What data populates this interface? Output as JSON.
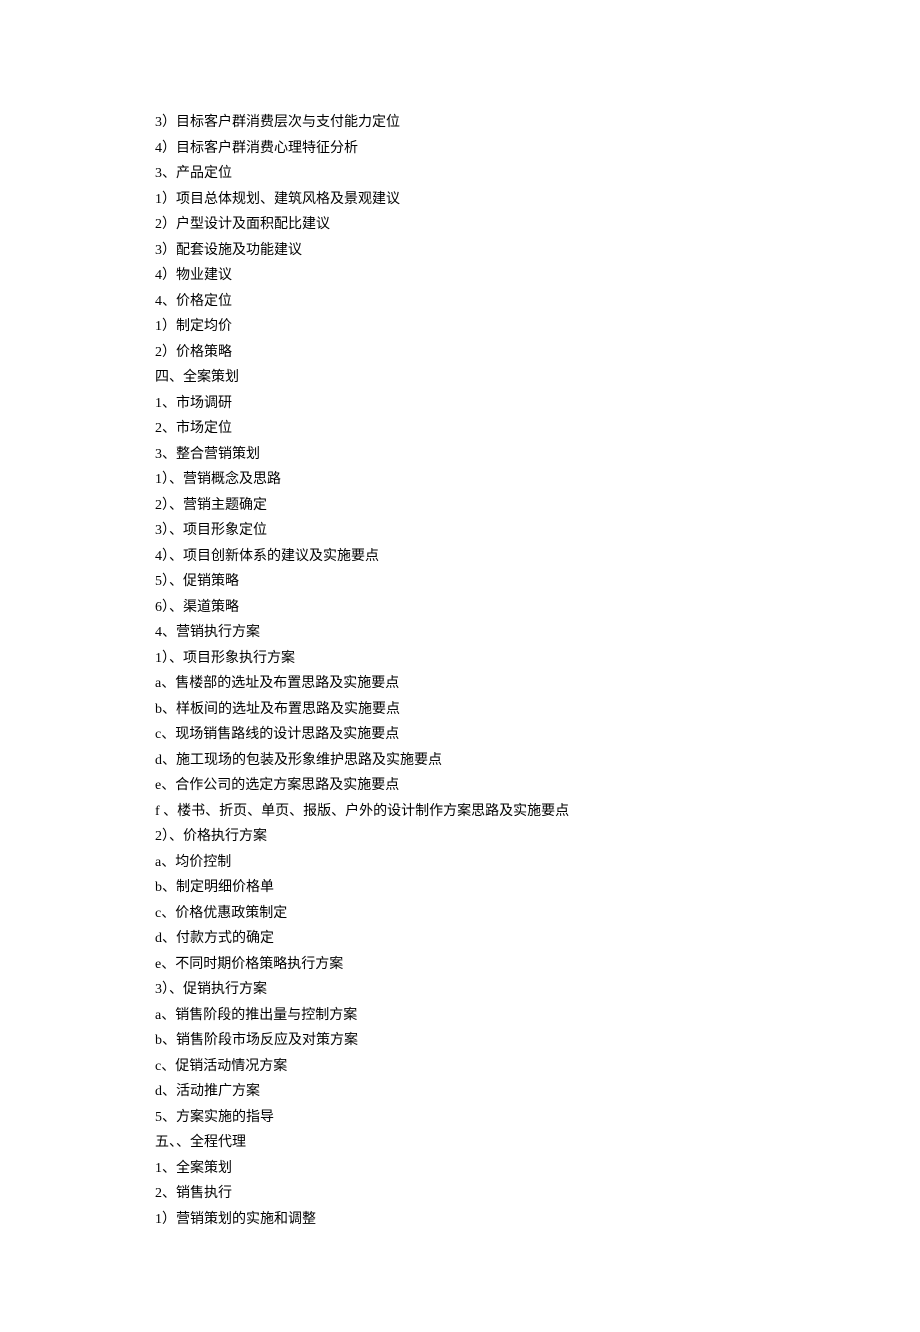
{
  "lines": [
    "3）目标客户群消费层次与支付能力定位",
    "4）目标客户群消费心理特征分析",
    "3、产品定位",
    "1）项目总体规划、建筑风格及景观建议",
    "2）户型设计及面积配比建议",
    "3）配套设施及功能建议",
    "4）物业建议",
    "4、价格定位",
    "1）制定均价",
    "2）价格策略",
    "四、全案策划",
    "1、市场调研",
    "2、市场定位",
    "3、整合营销策划",
    "1）、营销概念及思路",
    "2）、营销主题确定",
    "3）、项目形象定位",
    "4）、项目创新体系的建议及实施要点",
    "5）、促销策略",
    "6）、渠道策略",
    "4、营销执行方案",
    "1）、项目形象执行方案",
    "a、售楼部的选址及布置思路及实施要点",
    "b、样板间的选址及布置思路及实施要点",
    "c、现场销售路线的设计思路及实施要点",
    "d、施工现场的包装及形象维护思路及实施要点",
    "e、合作公司的选定方案思路及实施要点",
    "f 、楼书、折页、单页、报版、户外的设计制作方案思路及实施要点",
    "2）、价格执行方案",
    "a、均价控制",
    "b、制定明细价格单",
    "c、价格优惠政策制定",
    "d、付款方式的确定",
    "e、不同时期价格策略执行方案",
    "3）、促销执行方案",
    "a、销售阶段的推出量与控制方案",
    "b、销售阶段市场反应及对策方案",
    "c、促销活动情况方案",
    "d、活动推广方案",
    "5、方案实施的指导",
    "五、、全程代理",
    "1、全案策划",
    "2、销售执行",
    "1）营销策划的实施和调整"
  ]
}
